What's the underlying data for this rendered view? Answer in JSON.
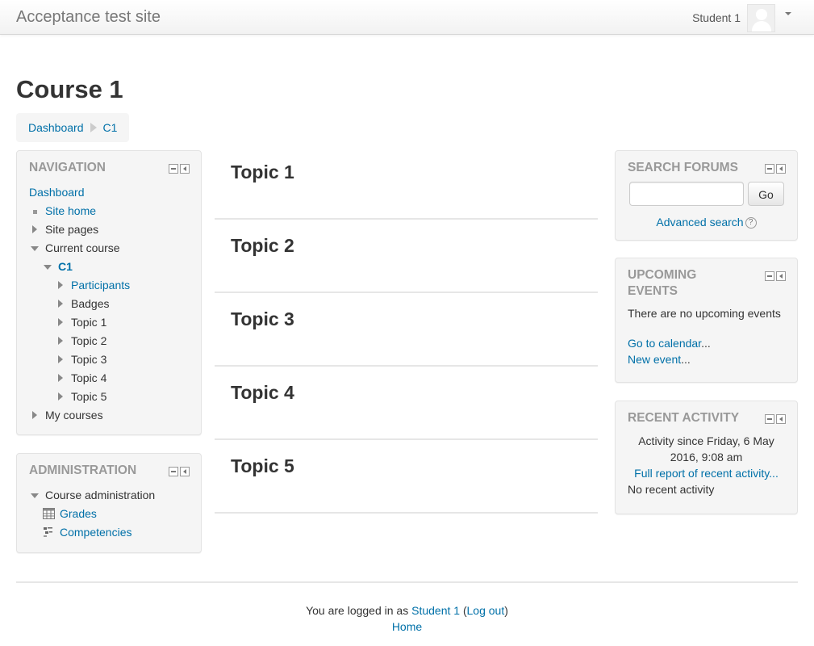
{
  "navbar": {
    "site_name": "Acceptance test site",
    "user_name": "Student 1",
    "avatar_icon": "user-avatar-icon",
    "menu_icon": "chevron-down-icon"
  },
  "page": {
    "title": "Course 1",
    "breadcrumb": [
      "Dashboard",
      "C1"
    ]
  },
  "navigation_block": {
    "title": "NAVIGATION",
    "items": {
      "dashboard": "Dashboard",
      "site_home": "Site home",
      "site_pages": "Site pages",
      "current_course": "Current course",
      "c1": "C1",
      "participants": "Participants",
      "badges": "Badges",
      "topic1": "Topic 1",
      "topic2": "Topic 2",
      "topic3": "Topic 3",
      "topic4": "Topic 4",
      "topic5": "Topic 5",
      "my_courses": "My courses"
    }
  },
  "administration_block": {
    "title": "ADMINISTRATION",
    "course_admin": "Course administration",
    "grades": "Grades",
    "competencies": "Competencies"
  },
  "topics": [
    "Topic 1",
    "Topic 2",
    "Topic 3",
    "Topic 4",
    "Topic 5"
  ],
  "search_forums": {
    "title": "SEARCH FORUMS",
    "input_value": "",
    "go_label": "Go",
    "advanced_search": "Advanced search",
    "help_icon": "help-icon"
  },
  "upcoming_events": {
    "title_line1": "UPCOMING",
    "title_line2": "EVENTS",
    "message": "There are no upcoming events",
    "go_to_calendar": "Go to calendar",
    "new_event": "New event",
    "ellipsis": "..."
  },
  "recent_activity": {
    "title": "RECENT ACTIVITY",
    "since_line1": "Activity since Friday, 6 May",
    "since_line2": "2016, 9:08 am",
    "full_report": "Full report of recent activity...",
    "no_activity": "No recent activity"
  },
  "footer": {
    "logged_in_prefix": "You are logged in as",
    "user_link": "Student 1",
    "logout_open": "(",
    "logout_link": "Log out",
    "logout_close": ")",
    "home_link": "Home"
  },
  "colors": {
    "link": "#0070a8",
    "block_bg": "#f5f5f5",
    "block_title": "#999999"
  }
}
